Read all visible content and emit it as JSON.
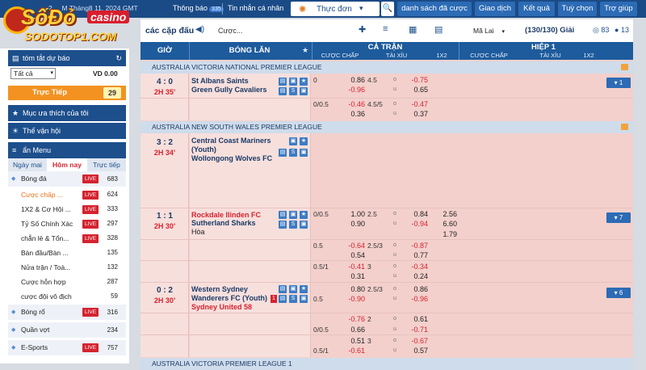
{
  "topbar": {
    "date": "2 ... M Tháng8 11, 2024 GMT",
    "notices_label": "Thông báo",
    "notices_count": "335",
    "messages_label": "Tin nhắn cá nhân",
    "menu_label": "Thực đơn",
    "buttons": [
      "danh sách đã cược",
      "Giao dịch",
      "Kết quả",
      "Tuỳ chọn",
      "Trợ giúp"
    ]
  },
  "logo": {
    "line1": "SốĐỏ",
    "line2": "casino",
    "line3": "SODOTOP1.COM"
  },
  "sidebar": {
    "quick_bet_title": "tóm tắt dự báo",
    "quick_select": "Tất cả",
    "balance": "VD 0.00",
    "live_label": "Trực Tiếp",
    "live_count": "29",
    "favorites_label": "Mục ưa thích của tôi",
    "olympics_label": "Thế vận hội",
    "hide_menu_label": "ẩn Menu",
    "tabs": [
      "Ngày mai",
      "Hôm nay",
      "Trực tiếp"
    ],
    "live_badge": "LIVE",
    "sports": [
      {
        "label": "Bóng đá",
        "count": "683",
        "live": true
      },
      {
        "label": "Bóng rổ",
        "count": "316",
        "live": true
      },
      {
        "label": "Quần vợt",
        "count": "234",
        "live": false
      },
      {
        "label": "E-Sports",
        "count": "757",
        "live": true
      }
    ],
    "football_sub": [
      {
        "label": "Cược chấp ...",
        "count": "624",
        "live": true
      },
      {
        "label": "1X2 & Cơ Hội ...",
        "count": "333",
        "live": true
      },
      {
        "label": "Tỷ Số Chính Xác",
        "count": "297",
        "live": true
      },
      {
        "label": "chẵn lẻ & Tổn...",
        "count": "328",
        "live": true
      },
      {
        "label": "Bàn đầu/Bàn ...",
        "count": "135",
        "live": false
      },
      {
        "label": "Nửa trận / Toà...",
        "count": "132",
        "live": false
      },
      {
        "label": "Cược hỗn hợp",
        "count": "287",
        "live": false
      },
      {
        "label": "cược đội vô địch",
        "count": "59",
        "live": false
      }
    ]
  },
  "controls": {
    "title": "các cặp đấu",
    "search": "Cược...",
    "market": "Mã Lai",
    "league_count": "(130/130) Giải",
    "count1": "83",
    "count2": "13"
  },
  "table_header": {
    "time": "GIỜ",
    "teams": "BÓNG LĂN",
    "full_time": "CẢ TRẬN",
    "half1": "HIỆP 1",
    "handicap": "CƯỢC CHẤP",
    "over_under": "TÀI XỈU",
    "x12": "1X2"
  },
  "leagues": [
    {
      "name": "AUSTRALIA VICTORIA NATIONAL PREMIER LEAGUE"
    },
    {
      "name": "AUSTRALIA NEW SOUTH WALES PREMIER LEAGUE"
    },
    {
      "name": "AUSTRALIA VICTORIA PREMIER LEAGUE 1"
    }
  ],
  "matches": [
    {
      "score": "4 : 0",
      "clock": "2H 35'",
      "home": "St Albans Saints",
      "away": "Green Gully Cavaliers",
      "more": "1",
      "lines": [
        {
          "hcap": "0",
          "h1": "0.86",
          "h2": "-0.96",
          "ou": "4.5",
          "o1": "o",
          "o2": "u",
          "ov1": "-0.75",
          "ov2": "0.65"
        },
        {
          "hcap": "0/0.5",
          "h1": "-0.46",
          "h2": "0.36",
          "ou": "4.5/5",
          "o1": "o",
          "o2": "u",
          "ov1": "-0.47",
          "ov2": "0.37"
        }
      ]
    },
    {
      "score": "3 : 2",
      "clock": "2H 34'",
      "home": "Central Coast Mariners (Youth)",
      "away": "Wollongong Wolves FC"
    },
    {
      "score": "1 : 1",
      "clock": "2H 30'",
      "home": "Rockdale Ilinden FC",
      "away": "Sutherland Sharks",
      "draw": "Hòa",
      "more": "7",
      "x12": [
        "2.56",
        "6.60",
        "1.79"
      ],
      "lines": [
        {
          "hcap": "0/0.5",
          "h1": "1.00",
          "h2": "0.90",
          "ou": "2.5",
          "o1": "o",
          "o2": "u",
          "ov1": "0.84",
          "ov2": "-0.94"
        },
        {
          "hcap": "0.5",
          "h1": "-0.64",
          "h2": "0.54",
          "ou": "2.5/3",
          "o1": "o",
          "o2": "u",
          "ov1": "-0.87",
          "ov2": "0.77"
        },
        {
          "hcap": "0.5/1",
          "h1": "-0.41",
          "h2": "0.31",
          "ou": "3",
          "o1": "o",
          "o2": "u",
          "ov1": "-0.34",
          "ov2": "0.24"
        }
      ]
    },
    {
      "score": "0 : 2",
      "clock": "2H 30'",
      "home": "Western Sydney Wanderers FC (Youth)",
      "away": "Sydney United 58",
      "red_cards": "1",
      "more": "6",
      "lines": [
        {
          "hcap": "0.5",
          "h1": "0.80",
          "h2": "-0.90",
          "ou": "2.5/3",
          "o1": "o",
          "o2": "u",
          "ov1": "0.86",
          "ov2": "-0.96"
        },
        {
          "hcap": "0/0.5",
          "h1": "-0.76",
          "h2": "0.66",
          "ou": "2",
          "o1": "o",
          "o2": "u",
          "ov1": "0.61",
          "ov2": "-0.71"
        },
        {
          "hcap": "0.5/1",
          "h1": "0.51",
          "h2": "-0.61",
          "ou": "3",
          "o1": "o",
          "o2": "u",
          "ov1": "-0.67",
          "ov2": "0.57"
        }
      ]
    }
  ]
}
